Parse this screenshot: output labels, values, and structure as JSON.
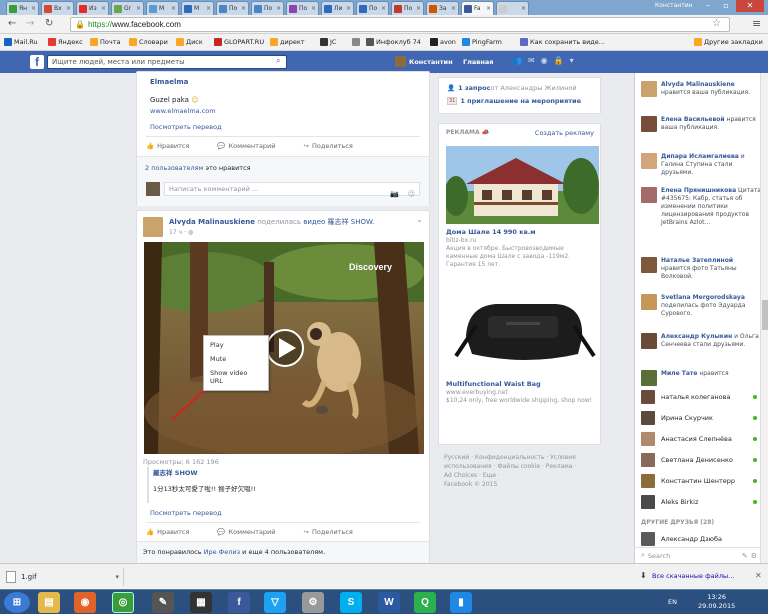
{
  "browser": {
    "tabs": [
      {
        "label": "Ян",
        "color": "#3b9c3b"
      },
      {
        "label": "Вх",
        "color": "#d44638"
      },
      {
        "label": "Из",
        "color": "#e52d27"
      },
      {
        "label": "Gr",
        "color": "#6aa84f"
      },
      {
        "label": "M",
        "color": "#5a9bd5"
      },
      {
        "label": "М",
        "color": "#2f6bbd"
      },
      {
        "label": "По",
        "color": "#4a86c5"
      },
      {
        "label": "По",
        "color": "#4a86c5"
      },
      {
        "label": "По",
        "color": "#8e44ad"
      },
      {
        "label": "Ли",
        "color": "#2f6bbd"
      },
      {
        "label": "По",
        "color": "#2f6bbd"
      },
      {
        "label": "По",
        "color": "#c0392b"
      },
      {
        "label": "За",
        "color": "#d35400"
      },
      {
        "label": "Fa",
        "color": "#3b5998"
      },
      {
        "label": "",
        "color": "#cccccc"
      }
    ],
    "active_tab_index": 13,
    "window_user": "Константин",
    "url_scheme": "https://",
    "url_host": "www.facebook.com",
    "bookmarks": [
      {
        "label": "Mail.Ru",
        "color": "#1565c0"
      },
      {
        "label": "Яндекс",
        "color": "#e53935"
      },
      {
        "label": "Почта",
        "color": "#f9a825"
      },
      {
        "label": "Словари",
        "color": "#f9a825"
      },
      {
        "label": "Диск",
        "color": "#f9a825"
      },
      {
        "label": "GLOPART.RU",
        "color": "#c62828"
      },
      {
        "label": "директ",
        "color": "#f9a825"
      },
      {
        "label": "JC",
        "color": "#333333"
      },
      {
        "label": "",
        "color": "#888888"
      },
      {
        "label": "Инфоклуб 74",
        "color": "#555555"
      },
      {
        "label": "avon",
        "color": "#222222"
      },
      {
        "label": "PingFarm",
        "color": "#1e88e5"
      },
      {
        "label": "Как сохранить виде...",
        "color": "#5c6bc0"
      },
      {
        "label": "Другие закладки",
        "color": "#f9a825"
      }
    ]
  },
  "fb": {
    "search_placeholder": "Ищите людей, места или предметы",
    "user_name": "Константин",
    "home_label": "Главная"
  },
  "post1": {
    "author": "Elmaelma",
    "text": "Guzel paka",
    "emoji": "☺",
    "link": "www.elmaelma.com",
    "translate": "Посмотреть перевод",
    "like": "Нравится",
    "comment": "Комментарий",
    "share": "Поделиться",
    "likes_count": "2 пользователям",
    "likes_suffix": " это нравится",
    "comment_placeholder": "Написать комментарий ..."
  },
  "post2": {
    "author": "Alvyda Malinauskiene",
    "action": " поделилась ",
    "video_word": "видео",
    "page_name": " 羅志祥 SHOW.",
    "time": "17 ч · ",
    "watermark": "Discovery",
    "views": "Просмотры: 6 162 196",
    "shared_page": "羅志祥 SHOW",
    "shared_text": "1分13秒太可愛了啦!! 猴子好欠唱!!",
    "translate": "Посмотреть перевод",
    "like": "Нравится",
    "comment": "Комментарий",
    "share": "Поделиться",
    "likes_prefix": "Это понравилось ",
    "likes_name": "Ире Фелиз",
    "likes_suffix": " и еще 4 пользователям.",
    "context_menu": [
      "Play",
      "Mute",
      "Show video URL"
    ]
  },
  "sidebar_ads": {
    "req_count": "1 запрос",
    "req_text": " от Александры Жилиной",
    "event_count": "1 приглашение на мероприятие",
    "event_badge": "31",
    "ads_label": "РЕКЛАМА",
    "create_ad": "Создать рекламу",
    "ad1_title": "Дома Шале 14 990 кв.м",
    "ad1_site": "bitiz-bx.ru",
    "ad1_text": "Акция в октябре. Быстровозводимые каменные дома Шале с завода -119м2. Гарантия 15 лет.",
    "ad2_title": "Multifunctional Waist Bag",
    "ad2_site": "www.everbuying.net",
    "ad2_text": "$10,24 only, free worldwide shipping, shop now!",
    "footer_1": "Русский · Конфиденциальность · Условия",
    "footer_2": "использования · Файлы cookie · Реклама ·",
    "footer_3": "Ad Choices · Еще ·",
    "footer_4": "Facebook © 2015"
  },
  "ticker": [
    {
      "name": "Alvyda Malinauskiene",
      "text": " нравится ваша публикация.",
      "color": "#c9a36b"
    },
    {
      "name": "Елена Васильевой",
      "text": " нравится ваша публикация.",
      "color": "#7a4d3a"
    },
    {
      "name": "Дипара Исламгалиева",
      "text": " и Галина Ступина стали друзьями.",
      "color": "#d2a67a"
    },
    {
      "name": "Елена Прянишникова",
      "text": " Цитата #435675: Кабр, статья об изменении политики лицензирования продуктов JetBrains Azlot...",
      "color": "#a56b6b"
    },
    {
      "name": "Наталье Затеплиной",
      "text": " нравится фото Татьяны Волковой.",
      "color": "#7d5a3c"
    },
    {
      "name": "Svetlana Mergorodskaya",
      "text": " поделилась фото Эдуарда Сурового.",
      "color": "#c7965b"
    },
    {
      "name": "Александр Кулыкин",
      "text": " и Ольга Сенчеева стали друзьями.",
      "color": "#6b4a3a"
    },
    {
      "name": "Миле Тате",
      "text": " нравится",
      "color": "#5a6e3a"
    }
  ],
  "friends": [
    {
      "name": "наталья колеганова",
      "color": "#6a4b3b"
    },
    {
      "name": "Ирина Скурчик",
      "color": "#5b4a3e"
    },
    {
      "name": "Анастасия Слепнёва",
      "color": "#b08a6a"
    },
    {
      "name": "Светлана Денисенко",
      "color": "#8a6a5b"
    },
    {
      "name": "Константин Шентерр",
      "color": "#8a6d3b"
    },
    {
      "name": "Aleks Birkiz",
      "color": "#4a4a4a"
    }
  ],
  "other_friends_label": "ДРУГИЕ ДРУЗЬЯ (28)",
  "other_friend": {
    "name": "Александр Дзюба",
    "color": "#5a5a5a"
  },
  "chat_search": "Search",
  "download": {
    "file": "1.gif",
    "show_all": "Все скачанные файлы..."
  },
  "taskbar": {
    "lang": "EN",
    "time": "13:26",
    "date": "29.09.2015"
  }
}
